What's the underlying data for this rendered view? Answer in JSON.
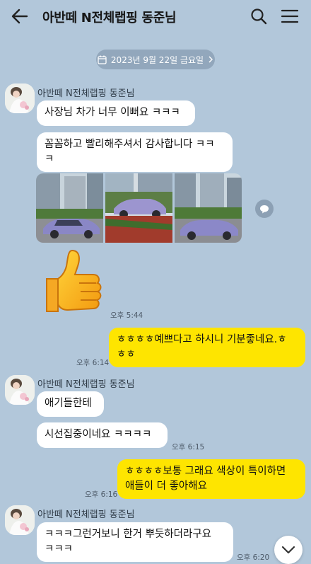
{
  "header": {
    "title": "아반떼 N전체랩핑 동준님",
    "icons": [
      "back-arrow-icon",
      "search-icon",
      "hamburger-menu-icon"
    ]
  },
  "date_divider": "2023년 9월 22일 금요일",
  "sender_name": "아반떼 N전체랩핑 동준님",
  "messages": [
    {
      "text": "사장님 차가 너무 이뻐요 ㅋㅋㅋ"
    },
    {
      "text": "꼼꼼하고 빨리해주셔서 감사합니다 ㅋㅋ\nㅋ"
    },
    {
      "time": "오후 5:44"
    },
    {
      "text": "ㅎㅎㅎㅎ예쁘다고 하시니 기분좋네요.ㅎ\nㅎㅎ",
      "time": "오후 6:14"
    },
    {
      "text": "애기들한테"
    },
    {
      "text": "시선집중이네요 ㅋㅋㅋㅋ",
      "time": "오후 6:15"
    },
    {
      "text": "ㅎㅎㅎㅎ보통 그래요 색상이 특이하면\n애들이 더 좋아해요",
      "time": "오후 6:16"
    },
    {
      "text": "ㅋㅋㅋ그런거보니 한거 뿌듯하더라구요\nㅋㅋㅋ",
      "time": "오후 6:20"
    }
  ],
  "colors": {
    "background": "#b2c7da",
    "incoming_bubble": "#ffffff",
    "outgoing_bubble": "#fee500"
  }
}
